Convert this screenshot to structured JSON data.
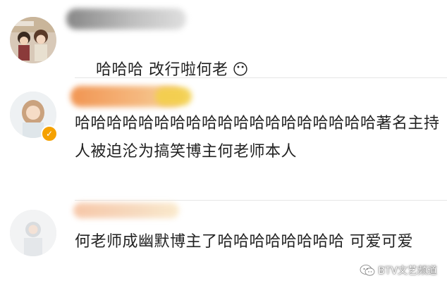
{
  "comments": [
    {
      "username_blurred": "aAXXay",
      "text": "哈哈哈 改行啦何老",
      "emoji": "😶"
    },
    {
      "username_blurred": "",
      "text": "哈哈哈哈哈哈哈哈哈哈哈哈哈哈哈哈哈哈哈著名主持人被迫沦为搞笑博主何老师本人",
      "verified": true
    },
    {
      "username_blurred": "",
      "text": "何老师成幽默博主了哈哈哈哈哈哈哈哈 可爱可爱"
    }
  ],
  "watermark": {
    "label": "BTV文艺频道",
    "icon": "wechat-icon"
  },
  "colors": {
    "verified_badge": "#f5a100",
    "blur_orange": "#f0a060",
    "blur_yellow": "#f5d060"
  }
}
